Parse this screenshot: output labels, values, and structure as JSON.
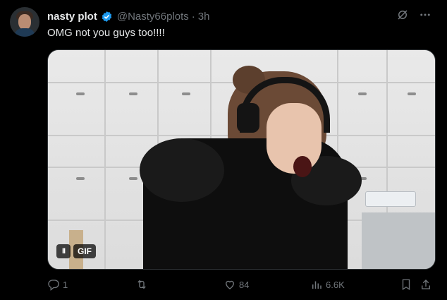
{
  "author": {
    "display_name": "nasty plot",
    "handle": "@Nasty66plots",
    "separator": "·",
    "time": "3h",
    "verified": true
  },
  "tweet": {
    "text": "OMG not you guys too!!!!"
  },
  "media": {
    "pause_symbol": "II",
    "gif_label": "GIF"
  },
  "actions": {
    "replies": "1",
    "reposts": "",
    "likes": "84",
    "views": "6.6K"
  },
  "colors": {
    "background": "#000000",
    "primary_text": "#e7e9ea",
    "secondary_text": "#71767b",
    "verified_blue": "#1d9bf0"
  },
  "icons": [
    "verified-badge-icon",
    "grok-icon",
    "more-icon",
    "reply-icon",
    "repost-icon",
    "like-icon",
    "views-icon",
    "bookmark-icon",
    "share-icon"
  ]
}
